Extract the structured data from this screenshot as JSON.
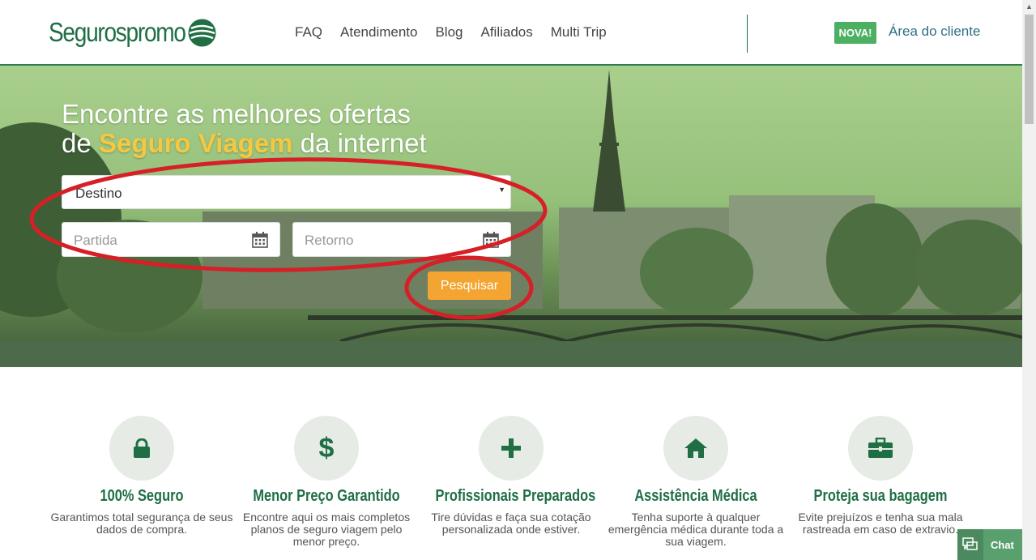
{
  "header": {
    "logo_text": "Segurospromo",
    "nav": [
      "FAQ",
      "Atendimento",
      "Blog",
      "Afiliados",
      "Multi Trip"
    ],
    "badge": "NOVA!",
    "client_link": "Área do cliente"
  },
  "hero": {
    "title_line1": "Encontre as melhores ofertas",
    "title_prefix": "de",
    "title_highlight": "Seguro Viagem",
    "title_suffix": "da internet",
    "destination_value": "Destino",
    "departure_placeholder": "Partida",
    "return_placeholder": "Retorno",
    "search_button": "Pesquisar"
  },
  "features": [
    {
      "icon": "lock-icon",
      "title": "100% Seguro",
      "text": "Garantimos total segurança de seus dados de compra."
    },
    {
      "icon": "dollar-icon",
      "title": "Menor Preço Garantido",
      "text": "Encontre aqui os mais completos planos de seguro viagem pelo menor preço."
    },
    {
      "icon": "plus-icon",
      "title": "Profissionais Preparados",
      "text": "Tire dúvidas e faça sua cotação personalizada onde estiver."
    },
    {
      "icon": "home-icon",
      "title": "Assistência Médica",
      "text": "Tenha suporte à qualquer emergência médica durante toda a sua viagem."
    },
    {
      "icon": "briefcase-icon",
      "title": "Proteja sua bagagem",
      "text": "Evite prejuízos e tenha sua mala rastreada em caso de extravio."
    }
  ],
  "chat": {
    "label": "Chat"
  },
  "colors": {
    "brand_green": "#1f6e44",
    "accent_orange": "#f4a531",
    "badge_green": "#4caf62",
    "annotation_red": "#d61f26"
  }
}
